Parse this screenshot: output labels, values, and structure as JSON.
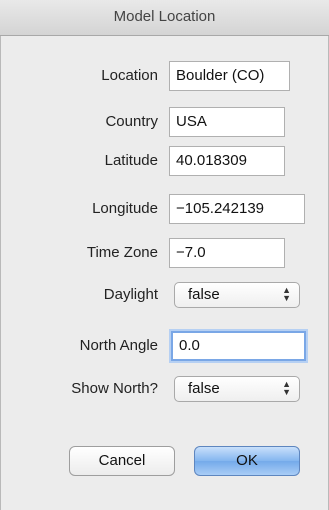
{
  "window": {
    "title": "Model Location"
  },
  "fields": {
    "location": {
      "label": "Location",
      "value": "Boulder (CO)"
    },
    "country": {
      "label": "Country",
      "value": "USA"
    },
    "latitude": {
      "label": "Latitude",
      "value": "40.018309"
    },
    "longitude": {
      "label": "Longitude",
      "value": "−105.242139"
    },
    "timezone": {
      "label": "Time Zone",
      "value": "−7.0"
    },
    "daylight": {
      "label": "Daylight",
      "value": "false"
    },
    "north_angle": {
      "label": "North Angle",
      "value": "0.0"
    },
    "show_north": {
      "label": "Show North?",
      "value": "false"
    }
  },
  "buttons": {
    "cancel": "Cancel",
    "ok": "OK"
  }
}
